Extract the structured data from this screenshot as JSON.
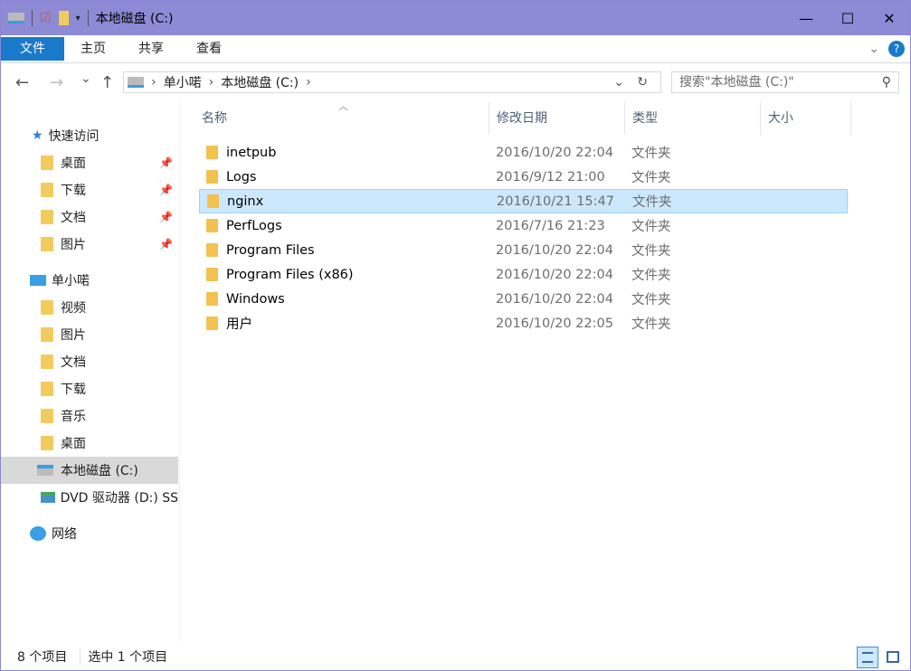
{
  "window": {
    "title": "本地磁盘 (C:)",
    "minimize": "—",
    "maximize": "☐",
    "close": "✕"
  },
  "ribbon": {
    "tabs": [
      "文件",
      "主页",
      "共享",
      "查看"
    ]
  },
  "nav": {
    "back": "←",
    "forward": "→",
    "recent": "⌄",
    "up": "↑",
    "refresh": "↻"
  },
  "address": {
    "crumbs": [
      "单小喏",
      "本地磁盘 (C:)"
    ]
  },
  "search": {
    "placeholder": "搜索\"本地磁盘 (C:)\""
  },
  "sidebar": {
    "quick_access": "快速访问",
    "quick": [
      "桌面",
      "下载",
      "文档",
      "图片"
    ],
    "pc": "单小喏",
    "pc_items": [
      "视频",
      "图片",
      "文档",
      "下载",
      "音乐",
      "桌面",
      "本地磁盘 (C:)",
      "DVD 驱动器 (D:) SS"
    ],
    "network": "网络"
  },
  "columns": [
    "名称",
    "修改日期",
    "类型",
    "大小"
  ],
  "files": [
    {
      "name": "inetpub",
      "date": "2016/10/20 22:04",
      "type": "文件夹"
    },
    {
      "name": "Logs",
      "date": "2016/9/12 21:00",
      "type": "文件夹"
    },
    {
      "name": "nginx",
      "date": "2016/10/21 15:47",
      "type": "文件夹"
    },
    {
      "name": "PerfLogs",
      "date": "2016/7/16 21:23",
      "type": "文件夹"
    },
    {
      "name": "Program Files",
      "date": "2016/10/20 22:04",
      "type": "文件夹"
    },
    {
      "name": "Program Files (x86)",
      "date": "2016/10/20 22:04",
      "type": "文件夹"
    },
    {
      "name": "Windows",
      "date": "2016/10/20 22:04",
      "type": "文件夹"
    },
    {
      "name": "用户",
      "date": "2016/10/20 22:05",
      "type": "文件夹"
    }
  ],
  "selected_index": 2,
  "status": {
    "count": "8 个项目",
    "selected": "选中 1 个项目"
  }
}
